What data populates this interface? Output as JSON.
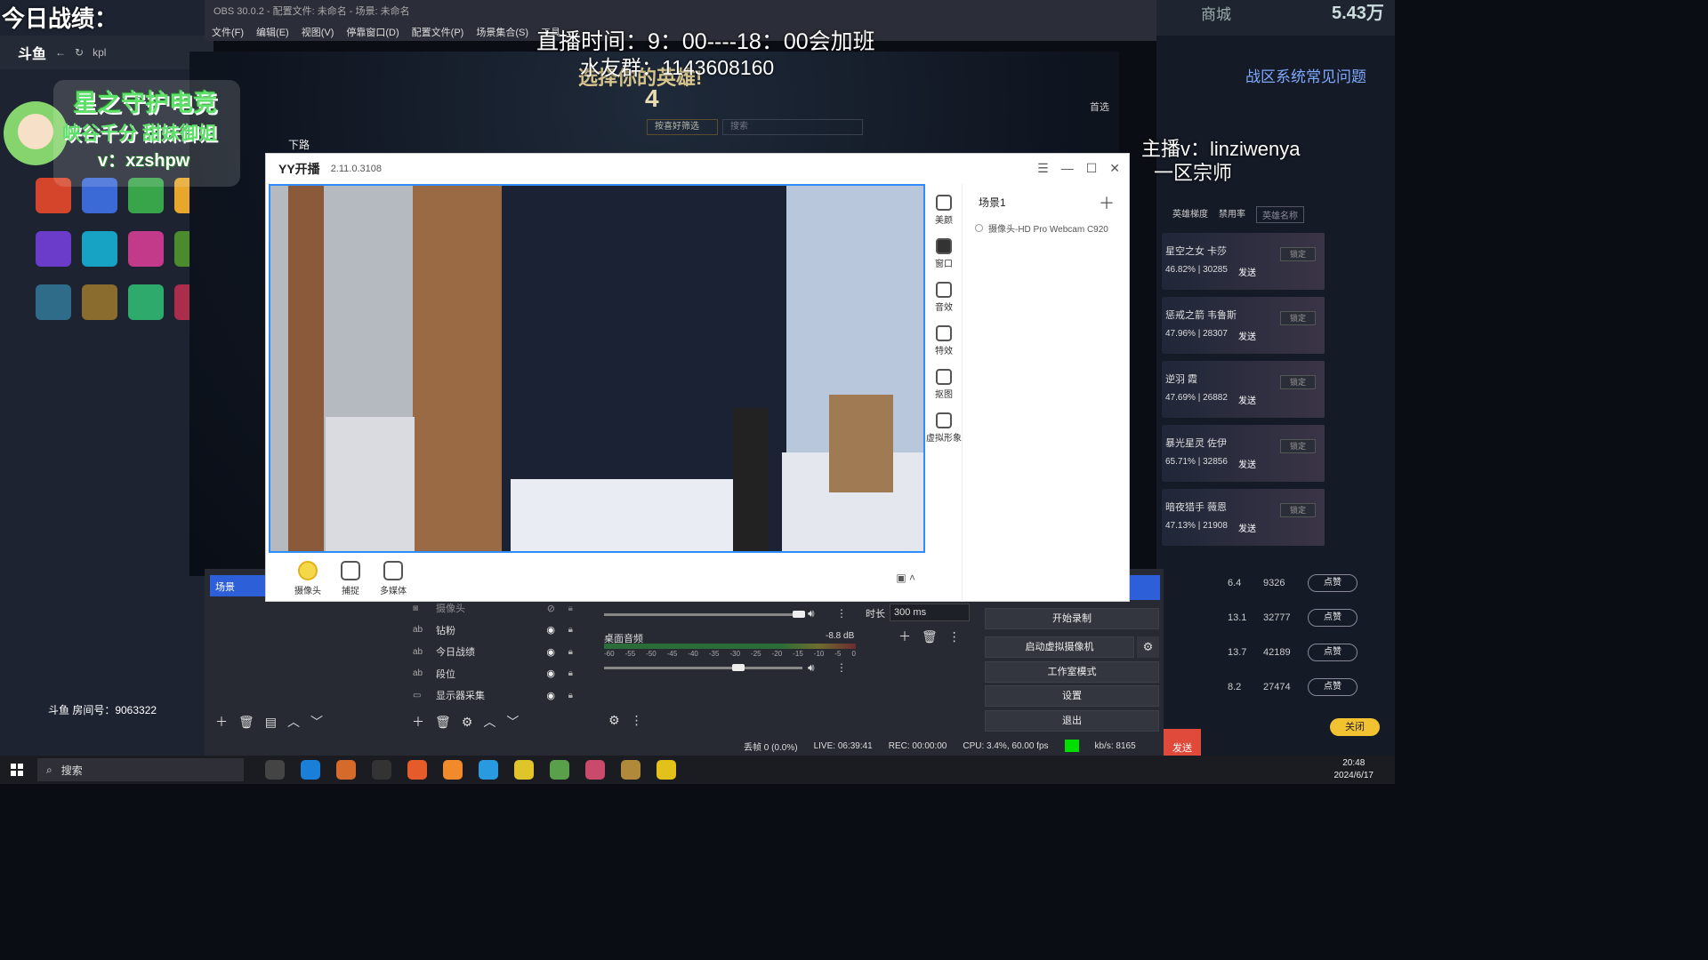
{
  "obs": {
    "title": "OBS 30.0.2 - 配置文件: 未命名 - 场景: 未命名",
    "menu": [
      "文件(F)",
      "编辑(E)",
      "视图(V)",
      "停靠窗口(D)",
      "配置文件(P)",
      "场景集合(S)",
      "工具"
    ],
    "scenes_header": "场景",
    "sources": [
      {
        "type": "cam",
        "name": "摄像头",
        "visible": false
      },
      {
        "type": "ab",
        "name": "钻粉",
        "visible": true
      },
      {
        "type": "ab",
        "name": "今日战绩",
        "visible": true
      },
      {
        "type": "ab",
        "name": "段位",
        "visible": true
      },
      {
        "type": "mon",
        "name": "显示器采集",
        "visible": true
      }
    ],
    "mixer": {
      "track_name": "桌面音频",
      "db": "-8.8 dB",
      "ticks": [
        "-60",
        "-55",
        "-50",
        "-45",
        "-40",
        "-35",
        "-30",
        "-25",
        "-20",
        "-15",
        "-10",
        "-5",
        "0"
      ]
    },
    "transition": {
      "label": "时长",
      "value": "300 ms"
    },
    "controls": [
      "开始录制",
      "启动虚拟摄像机",
      "工作室模式",
      "设置",
      "退出"
    ],
    "status": {
      "dropped": "丢帧 0 (0.0%)",
      "live": "LIVE: 06:39:41",
      "rec": "REC: 00:00:00",
      "cpu": "CPU: 3.4%, 60.00 fps",
      "kbs": "kb/s: 8165"
    }
  },
  "yy": {
    "app_name": "YY开播",
    "version": "2.11.0.3108",
    "tools": [
      "摄像头",
      "捕捉",
      "多媒体"
    ],
    "side": [
      "美颜",
      "窗口",
      "音效",
      "特效",
      "抠图",
      "虚拟形象"
    ],
    "scene_title": "场景1",
    "scene_source": "摄像头-HD Pro Webcam C920"
  },
  "game": {
    "title": "选择你的英雄!",
    "count": "4",
    "filter": "按喜好筛选",
    "search_placeholder": "搜索",
    "lane": "下路",
    "prefer": "首选"
  },
  "right_panel": {
    "rank_label": "商城",
    "rank_value": "5.43万",
    "faq": "战区系统常见问题",
    "tabs": [
      "英雄梯度",
      "禁用率"
    ],
    "search_placeholder": "英雄名称",
    "heroes": [
      {
        "name": "星空之女 卡莎",
        "stat": "46.82% | 30285",
        "send": "发送",
        "lock": "锁定"
      },
      {
        "name": "惩戒之箭 韦鲁斯",
        "stat": "47.96% | 28307",
        "send": "发送",
        "lock": "锁定"
      },
      {
        "name": "逆羽 霞",
        "stat": "47.69% | 26882",
        "send": "发送",
        "lock": "锁定"
      },
      {
        "name": "暴光星灵 佐伊",
        "stat": "65.71% | 32856",
        "send": "发送",
        "lock": "锁定"
      },
      {
        "name": "暗夜猎手 薇恩",
        "stat": "47.13% | 21908",
        "send": "发送",
        "lock": "锁定"
      }
    ],
    "rows": [
      {
        "a": "6.4",
        "b": "9326",
        "btn": "点赞"
      },
      {
        "a": "13.1",
        "b": "32777",
        "btn": "点赞"
      },
      {
        "a": "13.7",
        "b": "42189",
        "btn": "点赞"
      },
      {
        "a": "8.2",
        "b": "27474",
        "btn": "点赞"
      }
    ],
    "close_btn": "关闭",
    "send_btn": "发送"
  },
  "overlays": {
    "record": "今日战绩：",
    "time": "直播时间：9：00----18：00会加班",
    "qq": "水友群：1143608160",
    "anchor": "主播v：linziwenya",
    "rank": "一区宗师",
    "sticker_line1": "星之守护电竞",
    "sticker_line2": "峡谷千分 甜妹御姐",
    "sticker_line3": "v：xzshpw",
    "room_no": "斗鱼 房间号：9063322"
  },
  "douyu": {
    "logo": "斗鱼",
    "search": "kpl"
  },
  "taskbar": {
    "search": "搜索",
    "time": "20:48",
    "date": "2024/6/17"
  }
}
